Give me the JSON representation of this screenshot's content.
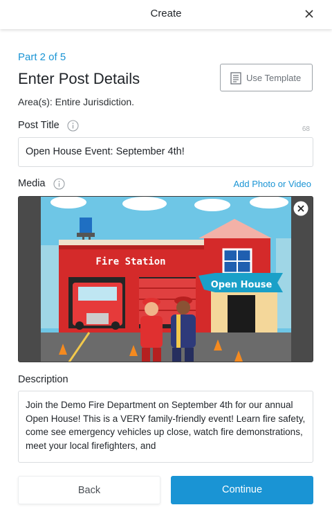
{
  "header": {
    "title": "Create",
    "close_icon": "close-icon"
  },
  "progress": {
    "part_label": "Part 2 of 5",
    "current": 2,
    "total": 5
  },
  "page": {
    "heading": "Enter Post Details"
  },
  "template_button": {
    "label": "Use Template",
    "icon": "document-icon"
  },
  "areas": {
    "text": "Area(s): Entire Jurisdiction."
  },
  "post_title": {
    "label": "Post Title",
    "char_count": "68",
    "value": "Open House Event: September 4th!"
  },
  "media": {
    "label": "Media",
    "add_link": "Add Photo or Video",
    "image": {
      "sign_text": "Fire Station",
      "banner_text": "Open House"
    }
  },
  "description": {
    "label": "Description",
    "value": "Join the Demo Fire Department on September 4th for our annual Open House! This is a VERY family-friendly event! Learn fire safety, come see emergency vehicles up close, watch fire demonstrations, meet your local firefighters, and"
  },
  "footer": {
    "back_label": "Back",
    "continue_label": "Continue"
  },
  "colors": {
    "accent": "#1a94d4",
    "text": "#1f2328",
    "border": "#d9dcdf"
  }
}
